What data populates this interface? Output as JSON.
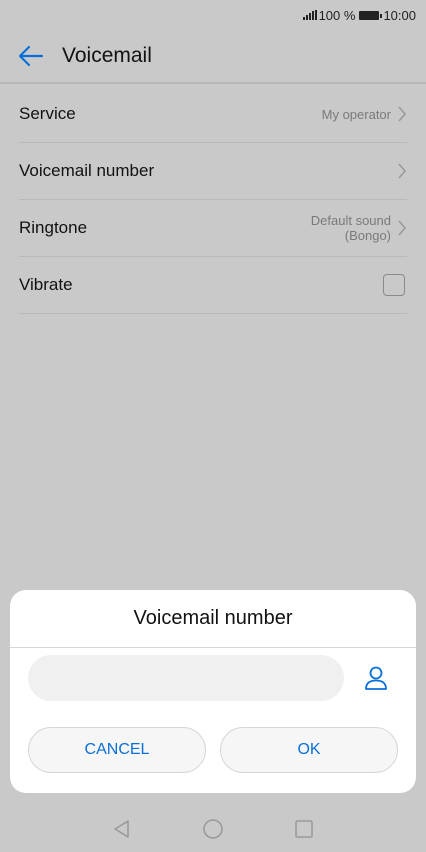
{
  "status_bar": {
    "battery": "100 %",
    "time": "10:00"
  },
  "header": {
    "title": "Voicemail"
  },
  "settings": {
    "service": {
      "label": "Service",
      "value": "My operator"
    },
    "voicemail_number": {
      "label": "Voicemail number"
    },
    "ringtone": {
      "label": "Ringtone",
      "value_line1": "Default sound",
      "value_line2": "(Bongo)"
    },
    "vibrate": {
      "label": "Vibrate",
      "checked": false
    }
  },
  "dialog": {
    "title": "Voicemail number",
    "input_value": "",
    "cancel_label": "CANCEL",
    "ok_label": "OK"
  },
  "colors": {
    "accent": "#0a6fd8",
    "background": "#c9c9c9",
    "dialog": "#ffffff"
  },
  "icons": [
    "signal-icon",
    "battery-icon",
    "back-arrow-icon",
    "chevron-right-icon",
    "contact-icon",
    "nav-back-icon",
    "nav-home-icon",
    "nav-recents-icon"
  ]
}
